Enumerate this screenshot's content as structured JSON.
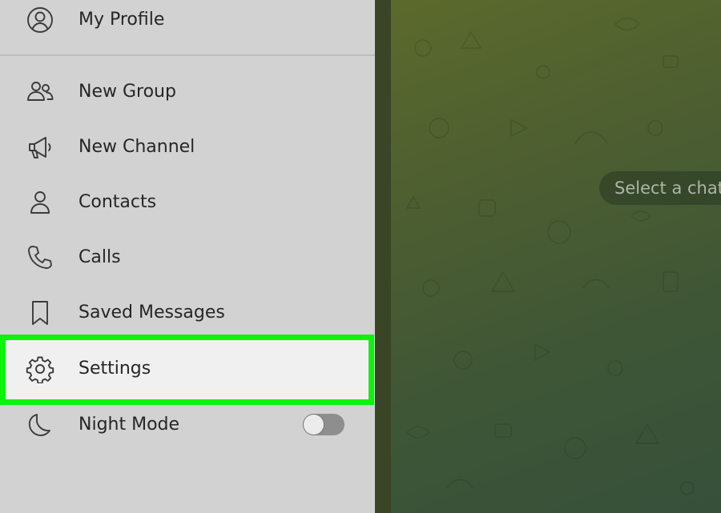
{
  "menu": {
    "items": [
      {
        "id": "my-profile",
        "label": "My Profile",
        "icon": "user-circle-icon"
      },
      {
        "id": "new-group",
        "label": "New Group",
        "icon": "group-icon"
      },
      {
        "id": "new-channel",
        "label": "New Channel",
        "icon": "megaphone-icon"
      },
      {
        "id": "contacts",
        "label": "Contacts",
        "icon": "person-icon"
      },
      {
        "id": "calls",
        "label": "Calls",
        "icon": "phone-icon"
      },
      {
        "id": "saved-messages",
        "label": "Saved Messages",
        "icon": "bookmark-icon"
      },
      {
        "id": "settings",
        "label": "Settings",
        "icon": "gear-icon",
        "highlighted": true
      },
      {
        "id": "night-mode",
        "label": "Night Mode",
        "icon": "moon-icon",
        "toggle_on": false
      }
    ]
  },
  "chat": {
    "placeholder": "Select a chat"
  },
  "colors": {
    "highlight_border": "#0ef20e",
    "menu_background": "#d2d2d2",
    "chat_background": "#4d5e31"
  }
}
